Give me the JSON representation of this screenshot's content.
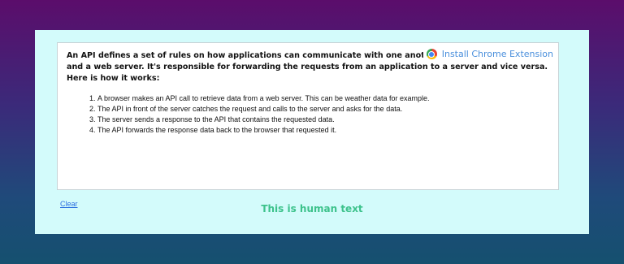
{
  "editor": {
    "intro_lines": [
      "An API defines a set of rules on how applications can communicate with one another. It is the midd",
      "and a web server. It's responsible for forwarding the requests from an application to a server and vice versa.",
      "Here is how it works:"
    ],
    "steps": [
      "A browser makes an API call to retrieve data from a web server. This can be weather data for example.",
      "The API in front of the server catches the request and calls to the server and asks for the data.",
      "The server sends a response to the API that contains the requested data.",
      "The API forwards the response data back to the browser that requested it."
    ]
  },
  "extension": {
    "label": "Install Chrome Extension",
    "icon": "chrome-icon"
  },
  "actions": {
    "clear_label": "Clear"
  },
  "result": {
    "text": "This is human text",
    "color": "#3cc28b"
  },
  "colors": {
    "panel": "#d3fbfb",
    "link": "#2a6ee0"
  }
}
